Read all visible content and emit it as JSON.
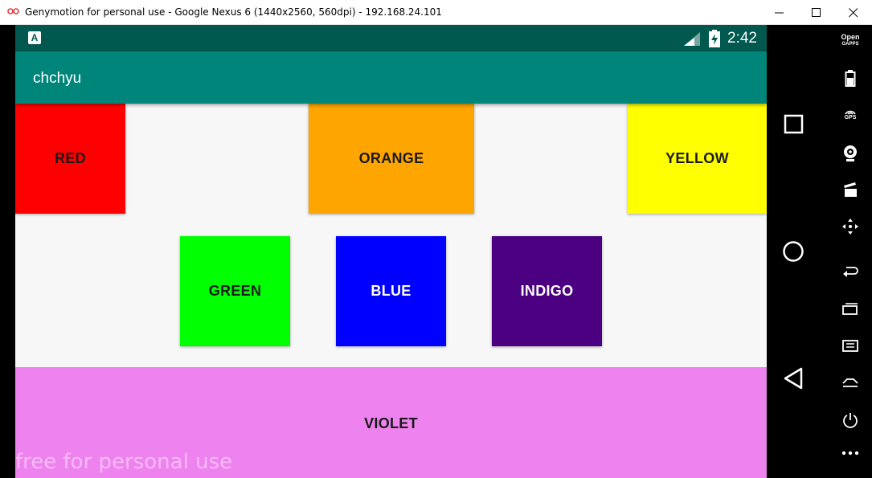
{
  "window": {
    "title": "Genymotion for personal use - Google Nexus 6 (1440x2560, 560dpi) - 192.168.24.101"
  },
  "status_bar": {
    "notification_icon": "A",
    "time": "2:42"
  },
  "app_bar": {
    "title": "chchyu"
  },
  "color_boxes": [
    {
      "label": "RED",
      "color": "#ff0000"
    },
    {
      "label": "ORANGE",
      "color": "#ffa500"
    },
    {
      "label": "YELLOW",
      "color": "#ffff00"
    },
    {
      "label": "GREEN",
      "color": "#00ff00"
    },
    {
      "label": "BLUE",
      "color": "#0000ff"
    },
    {
      "label": "INDIGO",
      "color": "#4b0082"
    },
    {
      "label": "VIOLET",
      "color": "#ee82ee"
    }
  ],
  "watermark": "free for personal use",
  "toolbar": {
    "open_gapps_label_1": "Open",
    "open_gapps_label_2": "GAPPS",
    "gps_label": "GPS"
  }
}
